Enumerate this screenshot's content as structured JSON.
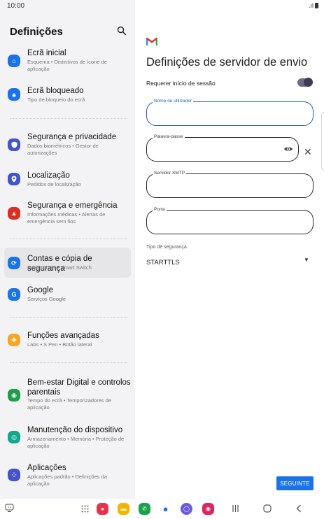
{
  "status_bar": {
    "time": "10:00"
  },
  "settings": {
    "title": "Definições",
    "items": [
      {
        "title": "Ecrã inicial",
        "subtitle": "Esquema • Distintivos de ícone de aplicação",
        "icon": "home-icon",
        "color": "#1b73e8"
      },
      {
        "title": "Ecrã bloqueado",
        "subtitle": "Tipo de bloqueio do ecrã",
        "icon": "lock-icon",
        "color": "#1b73e8"
      },
      {
        "title": "Segurança e privacidade",
        "subtitle": "Dados biométricos • Gestor de autorizações",
        "icon": "shield-icon",
        "color": "#4553c9"
      },
      {
        "title": "Localização",
        "subtitle": "Pedidos de localização",
        "icon": "location-pin-icon",
        "color": "#4553c9"
      },
      {
        "title": "Segurança e emergência",
        "subtitle": "Informações médicas • Alertas de emergência sem fios",
        "icon": "emergency-icon",
        "color": "#d93025"
      },
      {
        "title": "Contas e cópia de segurança",
        "subtitle": "Gerir contas • Smart Switch",
        "icon": "sync-icon",
        "color": "#1b73e8"
      },
      {
        "title": "Google",
        "subtitle": "Serviços Google",
        "icon": "google-icon",
        "color": "#1b73e8"
      },
      {
        "title": "Funções avançadas",
        "subtitle": "Labs • S Pen • Botão lateral",
        "icon": "gear-plus-icon",
        "color": "#f5a623"
      },
      {
        "title": "Bem-estar Digital e controlos parentais",
        "subtitle": "Tempo do ecrã • Temporizadores de aplicação",
        "icon": "wellbeing-icon",
        "color": "#1e9e4a"
      },
      {
        "title": "Manutenção do dispositivo",
        "subtitle": "Armazenamento • Memória • Proteção de aplicação",
        "icon": "maintenance-icon",
        "color": "#13a889"
      },
      {
        "title": "Aplicações",
        "subtitle": "Aplicações padrão • Definições da aplicação",
        "icon": "apps-icon",
        "color": "#4553c9"
      }
    ]
  },
  "outgoing": {
    "title": "Definições de servidor de envio",
    "require_login_label": "Requerer início de sessão",
    "require_login_on": true,
    "fields": {
      "username_label": "Nome de utilizador",
      "password_label": "Palavra-passe",
      "smtp_label": "Servidor SMTP",
      "port_label": "Porta"
    },
    "security_type_label": "Tipo de segurança",
    "security_type_value": "STARTTLS",
    "next_button": "SEGUINTE"
  },
  "colors": {
    "accent": "#1a73e8",
    "toggle_on": "#3e3a52"
  }
}
